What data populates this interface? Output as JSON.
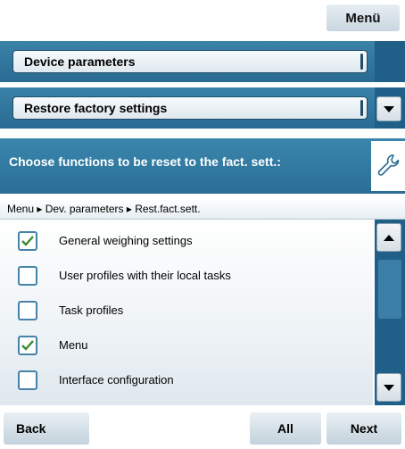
{
  "top": {
    "menu_label": "Menü"
  },
  "dropdowns": [
    {
      "label": "Device parameters"
    },
    {
      "label": "Restore factory settings"
    }
  ],
  "dialog": {
    "title": "Choose functions to be reset to the fact. sett.:",
    "breadcrumb": "Menu ▸ Dev. parameters ▸ Rest.fact.sett.",
    "items": [
      {
        "label": "General weighing settings",
        "checked": true
      },
      {
        "label": "User profiles with their local tasks",
        "checked": false
      },
      {
        "label": "Task profiles",
        "checked": false
      },
      {
        "label": "Menu",
        "checked": true
      },
      {
        "label": "Interface configuration",
        "checked": false
      }
    ]
  },
  "bottom": {
    "back_label": "Back",
    "all_label": "All",
    "next_label": "Next"
  },
  "colors": {
    "accent": "#2b6e95",
    "dark": "#1f5f88",
    "check": "#3a8a2e"
  }
}
